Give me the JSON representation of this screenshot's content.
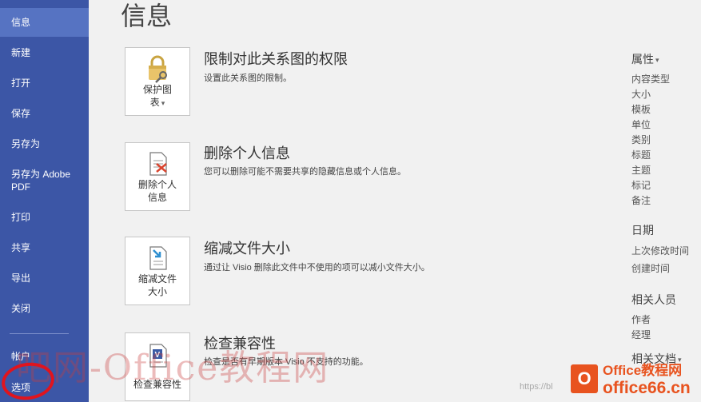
{
  "sidebar": {
    "items": [
      {
        "label": "信息"
      },
      {
        "label": "新建"
      },
      {
        "label": "打开"
      },
      {
        "label": "保存"
      },
      {
        "label": "另存为"
      },
      {
        "label": "另存为 Adobe PDF"
      },
      {
        "label": "打印"
      },
      {
        "label": "共享"
      },
      {
        "label": "导出"
      },
      {
        "label": "关闭"
      },
      {
        "label": "帐户"
      },
      {
        "label": "选项"
      }
    ]
  },
  "main": {
    "title": "信息",
    "sections": [
      {
        "button_label": "保护图表",
        "title": "限制对此关系图的权限",
        "desc": "设置此关系图的限制。"
      },
      {
        "button_label": "删除个人信息",
        "title": "删除个人信息",
        "desc": "您可以删除可能不需要共享的隐藏信息或个人信息。"
      },
      {
        "button_label": "缩减文件大小",
        "title": "缩减文件大小",
        "desc": "通过让 Visio 删除此文件中不使用的项可以减小文件大小。"
      },
      {
        "button_label": "检查兼容性",
        "title": "检查兼容性",
        "desc": "检查是否有早期版本 Visio 不支持的功能。"
      }
    ]
  },
  "properties": {
    "heading": "属性",
    "items": [
      "内容类型",
      "大小",
      "模板",
      "单位",
      "类别",
      "标题",
      "主题",
      "标记",
      "备注"
    ],
    "dates_heading": "日期",
    "dates": [
      "上次修改时间",
      "创建时间"
    ],
    "people_heading": "相关人员",
    "people": [
      "作者",
      "经理"
    ],
    "docs_heading": "相关文档"
  },
  "watermark": {
    "text": "吧网-Office教程网",
    "logo_letter": "O",
    "logo_line1": "Office教程网",
    "logo_line2": "office66.cn",
    "csdn": "https://bl"
  },
  "colors": {
    "sidebar": "#3c56a6",
    "sidebar_active": "#5673c2",
    "highlight_circle": "#e0141e"
  }
}
